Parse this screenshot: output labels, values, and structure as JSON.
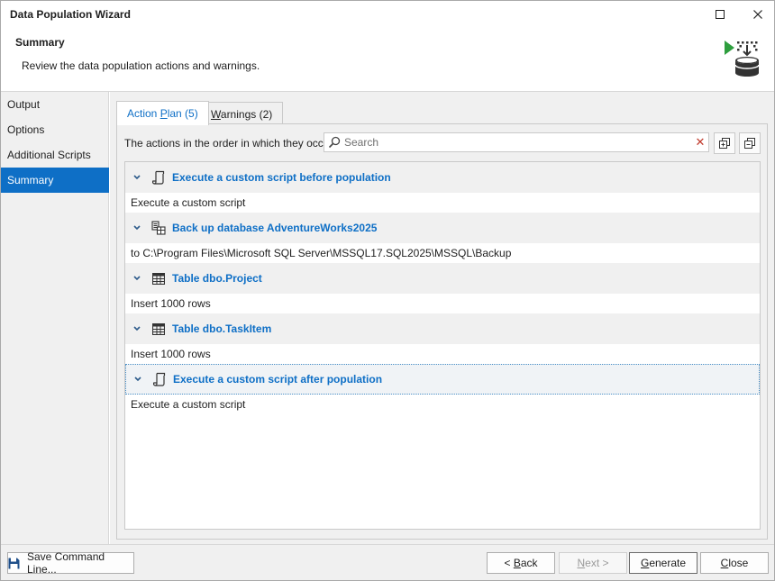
{
  "window": {
    "title": "Data Population Wizard",
    "maximize_icon": "maximize-icon",
    "close_icon": "close-icon"
  },
  "header": {
    "title": "Summary",
    "subtitle": "Review the data population actions and warnings.",
    "icon": "database-import-icon"
  },
  "sidebar": {
    "items": [
      {
        "label": "Output",
        "active": false
      },
      {
        "label": "Options",
        "active": false
      },
      {
        "label": "Additional Scripts",
        "active": false
      },
      {
        "label": "Summary",
        "active": true
      }
    ]
  },
  "tabs": {
    "action_plan": {
      "prefix": "Action ",
      "mnemonic": "P",
      "suffix": "lan (5)"
    },
    "warnings": {
      "prefix": "",
      "mnemonic": "W",
      "suffix": "arnings (2)"
    }
  },
  "panel": {
    "description": "The actions in the order in which they occur.",
    "search_placeholder": "Search",
    "search_value": "",
    "clear_icon": "clear-x-icon",
    "expand_all_icon": "expand-all-icon",
    "collapse_all_icon": "collapse-all-icon"
  },
  "actions": [
    {
      "icon": "script-icon",
      "title": "Execute a custom script before population",
      "detail": "Execute a custom script"
    },
    {
      "icon": "backup-database-icon",
      "title": "Back up database AdventureWorks2025",
      "detail": "to C:\\Program Files\\Microsoft SQL Server\\MSSQL17.SQL2025\\MSSQL\\Backup"
    },
    {
      "icon": "table-icon",
      "title": "Table dbo.Project",
      "detail": "Insert 1000 rows"
    },
    {
      "icon": "table-icon",
      "title": "Table dbo.TaskItem",
      "detail": "Insert 1000 rows"
    },
    {
      "icon": "script-icon",
      "title": "Execute a custom script after population",
      "detail": "Execute a custom script"
    }
  ],
  "footer": {
    "save_command_line": "Save Command Line...",
    "back": {
      "prefix": "< ",
      "mnemonic": "B",
      "suffix": "ack"
    },
    "next": {
      "prefix": "",
      "mnemonic": "N",
      "suffix": "ext >"
    },
    "generate": {
      "prefix": "",
      "mnemonic": "G",
      "suffix": "enerate"
    },
    "close": {
      "prefix": "",
      "mnemonic": "C",
      "suffix": "lose"
    }
  },
  "colors": {
    "accent": "#0e6fc6",
    "sidebar_bg": "#f0f0f0",
    "icon_green": "#2e9e3e"
  }
}
